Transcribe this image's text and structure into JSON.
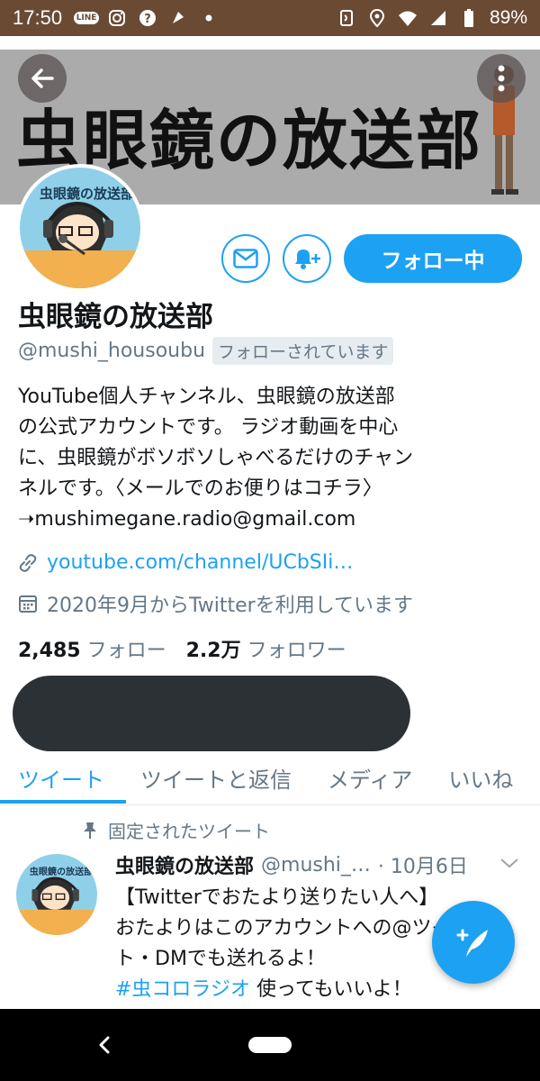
{
  "status_bar": {
    "time": "17:50",
    "line_badge": "LINE",
    "battery": "89%"
  },
  "profile": {
    "name": "虫眼鏡の放送部",
    "handle": "@mushi_housoubu",
    "follows_you": "フォローされています",
    "banner_text": "虫眼鏡の放送部",
    "bio_lines": [
      "YouTube個人チャンネル、虫眼鏡の放送部",
      "の公式アカウントです。 ラジオ動画を中心",
      "に、虫眼鏡がボソボソしゃべるだけのチャン",
      "ネルです。〈メールでのお便りはコチラ〉",
      "➝mushimegane.radio@gmail.com"
    ],
    "link": "youtube.com/channel/UCbSIi…",
    "joined": "2020年9月からTwitterを利用しています",
    "following_count": "2,485",
    "following_label": "フォロー",
    "followers_count": "2.2万",
    "followers_label": "フォロワー"
  },
  "actions": {
    "follow_label": "フォロー中"
  },
  "tabs": [
    "ツイート",
    "ツイートと返信",
    "メディア",
    "いいね"
  ],
  "pinned_tweet": {
    "pinned_label": "固定されたツイート",
    "name": "虫眼鏡の放送部",
    "handle": "@mushi_…",
    "date": "· 10月6日",
    "lines": [
      "【Twitterでおたより送りたい人へ】",
      "おたよりはこのアカウントへの@ツイー",
      "ト・DMでも送れるよ！"
    ],
    "hashtag": "#虫コロラジオ",
    "last_line_rest": " 使ってもいいよ！"
  },
  "colors": {
    "accent": "#1da1f2",
    "statusbar": "#6b4a34"
  }
}
